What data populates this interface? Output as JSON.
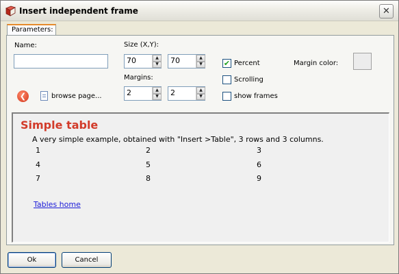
{
  "window": {
    "title": "Insert independent frame",
    "close_glyph": "✕"
  },
  "tabs": [
    {
      "label": "Parameters:"
    }
  ],
  "form": {
    "name_label": "Name:",
    "name_value": "",
    "size_label": "Size (X,Y):",
    "size_x": "70",
    "size_y": "70",
    "margins_label": "Margins:",
    "margin_x": "2",
    "margin_y": "2",
    "percent_label": "Percent",
    "percent_checked": true,
    "scrolling_label": "Scrolling",
    "scrolling_checked": false,
    "show_frames_label": "show frames",
    "show_frames_checked": false,
    "margin_color_label": "Margin color:",
    "margin_color": "#ececec",
    "browse_label": "browse page..."
  },
  "preview": {
    "title": "Simple table",
    "description": "A very simple example, obtained with \"Insert >Table\", 3 rows and 3 columns.",
    "rows": [
      [
        "1",
        "2",
        "3"
      ],
      [
        "4",
        "5",
        "6"
      ],
      [
        "7",
        "8",
        "9"
      ]
    ],
    "link": "Tables home"
  },
  "buttons": {
    "ok": "Ok",
    "cancel": "Cancel"
  },
  "colors": {
    "accent_tab": "#e68b2c",
    "preview_title": "#d23b2a",
    "link": "#1a1ad8"
  },
  "icons": [
    "book-icon",
    "close-icon",
    "back-arrow-icon",
    "page-icon",
    "spin-up-icon",
    "spin-down-icon",
    "checkmark-icon"
  ]
}
